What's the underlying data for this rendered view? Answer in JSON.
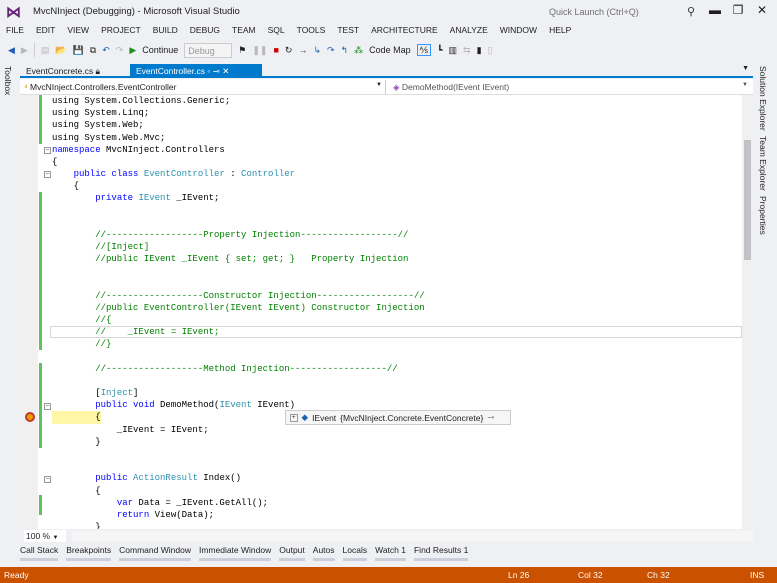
{
  "window": {
    "title": "MvcNInject (Debugging) - Microsoft Visual Studio",
    "quick_launch_placeholder": "Quick Launch (Ctrl+Q)"
  },
  "menu": [
    "FILE",
    "EDIT",
    "VIEW",
    "PROJECT",
    "BUILD",
    "DEBUG",
    "TEAM",
    "SQL",
    "TOOLS",
    "TEST",
    "ARCHITECTURE",
    "ANALYZE",
    "WINDOW",
    "HELP"
  ],
  "toolbar": {
    "continue_label": "Continue",
    "config_value": "Debug",
    "code_map_label": "Code Map"
  },
  "side_tabs": {
    "toolbox": "Toolbox",
    "solution_explorer": "Solution Explorer",
    "team_explorer": "Team Explorer",
    "properties": "Properties"
  },
  "doc_tabs": [
    {
      "label": "EventConcrete.cs"
    },
    {
      "label": "EventController.cs"
    }
  ],
  "nav": {
    "type": "MvcNInject.Controllers.EventController",
    "member": "DemoMethod(IEvent IEvent)"
  },
  "code": [
    [
      [
        "using System.Collections.Generic;",
        "pl"
      ]
    ],
    [
      [
        "using System.Linq;",
        "pl"
      ]
    ],
    [
      [
        "using System.Web;",
        "pl"
      ]
    ],
    [
      [
        "using System.Web.Mvc;",
        "pl"
      ]
    ],
    [
      [
        "namespace",
        "kw"
      ],
      [
        " MvcNInject.Controllers",
        "pl"
      ]
    ],
    [
      [
        "{",
        "pl"
      ]
    ],
    [
      [
        "    ",
        "pl"
      ],
      [
        "public class ",
        "kw"
      ],
      [
        "EventController",
        "ty"
      ],
      [
        " : ",
        "pl"
      ],
      [
        "Controller",
        "ty"
      ]
    ],
    [
      [
        "    {",
        "pl"
      ]
    ],
    [
      [
        "        ",
        "pl"
      ],
      [
        "private ",
        "kw"
      ],
      [
        "IEvent",
        "ty"
      ],
      [
        " _IEvent;",
        "pl"
      ]
    ],
    [],
    [],
    [
      [
        "        //------------------Property Injection------------------//",
        "cm"
      ]
    ],
    [
      [
        "        //[Inject]",
        "cm"
      ]
    ],
    [
      [
        "        //public IEvent _IEvent { set; get; }   Property Injection",
        "cm"
      ]
    ],
    [],
    [],
    [
      [
        "        //------------------Constructor Injection------------------//",
        "cm"
      ]
    ],
    [
      [
        "        //public EventController(IEvent IEvent) Constructor Injection",
        "cm"
      ]
    ],
    [
      [
        "        //{",
        "cm"
      ]
    ],
    [
      [
        "        //    _IEvent = IEvent;",
        "cm"
      ]
    ],
    [
      [
        "        //}",
        "cm"
      ]
    ],
    [],
    [
      [
        "        //------------------Method Injection------------------//",
        "cm"
      ]
    ],
    [],
    [
      [
        "        [",
        "pl"
      ],
      [
        "Inject",
        "ty"
      ],
      [
        "]",
        "pl"
      ]
    ],
    [
      [
        "        ",
        "pl"
      ],
      [
        "public void ",
        "kw"
      ],
      [
        "DemoMethod(",
        "pl"
      ],
      [
        "IEvent",
        "ty"
      ],
      [
        " IEvent)",
        "pl"
      ]
    ],
    [
      [
        "        {",
        "pl"
      ]
    ],
    [
      [
        "            _IEvent = IEvent;",
        "pl"
      ]
    ],
    [
      [
        "        }",
        "pl"
      ]
    ],
    [],
    [],
    [
      [
        "        ",
        "pl"
      ],
      [
        "public ",
        "kw"
      ],
      [
        "ActionResult",
        "ty"
      ],
      [
        " Index()",
        "pl"
      ]
    ],
    [
      [
        "        {",
        "pl"
      ]
    ],
    [
      [
        "            ",
        "pl"
      ],
      [
        "var ",
        "kw"
      ],
      [
        "Data = _IEvent.GetAll();",
        "pl"
      ]
    ],
    [
      [
        "            ",
        "pl"
      ],
      [
        "return ",
        "kw"
      ],
      [
        "View(Data);",
        "pl"
      ]
    ],
    [
      [
        "        }",
        "pl"
      ]
    ]
  ],
  "datatip": {
    "name": "IEvent",
    "value": "{MvcNInject.Concrete.EventConcrete}"
  },
  "zoom": "100 %",
  "bottom_tabs": [
    "Call Stack",
    "Breakpoints",
    "Command Window",
    "Immediate Window",
    "Output",
    "Autos",
    "Locals",
    "Watch 1",
    "Find Results 1"
  ],
  "status": {
    "text": "Ready",
    "ln": "Ln 26",
    "col": "Col 32",
    "ch": "Ch 32",
    "mode": "INS"
  },
  "colors": {
    "accent": "#007acc",
    "status_bar": "#ca5100"
  }
}
